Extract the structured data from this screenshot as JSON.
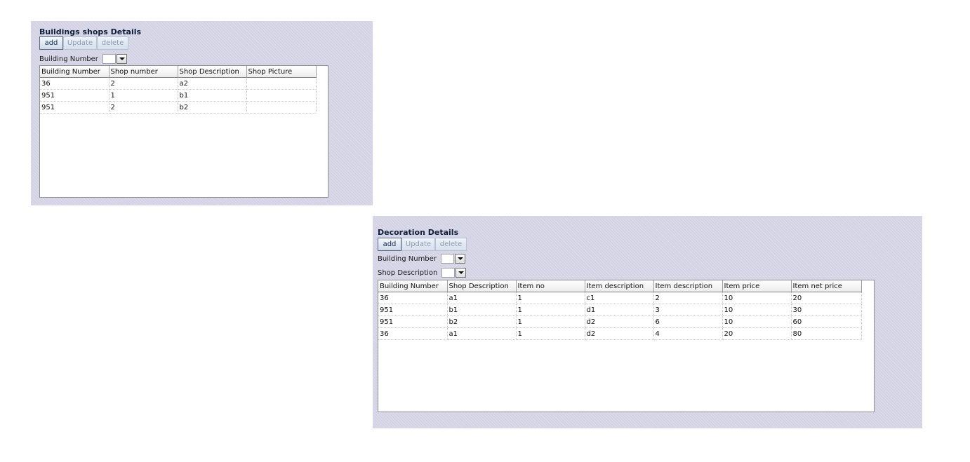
{
  "shops_panel": {
    "title": "Buildings shops Details",
    "buttons": {
      "add": "add",
      "update": "Update",
      "delete": "delete"
    },
    "filters": {
      "building_number_label": "Building Number"
    },
    "table": {
      "columns": [
        "Building Number",
        "Shop number",
        "Shop Description",
        "Shop Picture"
      ],
      "rows": [
        [
          "36",
          "2",
          "a2",
          ""
        ],
        [
          "951",
          "1",
          "b1",
          ""
        ],
        [
          "951",
          "2",
          "b2",
          ""
        ]
      ]
    }
  },
  "decoration_panel": {
    "title": "Decoration Details",
    "buttons": {
      "add": "add",
      "update": "Update",
      "delete": "delete"
    },
    "filters": {
      "building_number_label": "Building Number",
      "shop_description_label": "Shop Description"
    },
    "table": {
      "columns": [
        "Building Number",
        "Shop Description",
        "Item no",
        "Item description",
        "Item description",
        "Item price",
        "Item net price"
      ],
      "rows": [
        [
          "36",
          "a1",
          "1",
          "c1",
          "2",
          "10",
          "20"
        ],
        [
          "951",
          "b1",
          "1",
          "d1",
          "3",
          "10",
          "30"
        ],
        [
          "951",
          "b2",
          "1",
          "d2",
          "6",
          "10",
          "60"
        ],
        [
          "36",
          "a1",
          "1",
          "d2",
          "4",
          "20",
          "80"
        ]
      ]
    }
  }
}
